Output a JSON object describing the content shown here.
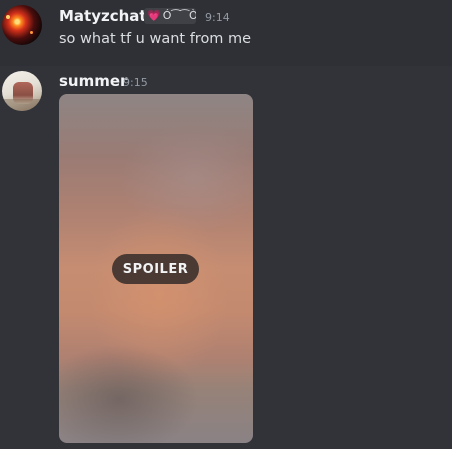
{
  "messages": [
    {
      "author": "Matyzchaty",
      "role_tag": {
        "icon": "heart-icon",
        "text": "Ó⁀⁀Ò"
      },
      "timestamp": "9:14",
      "content": "so what tf u want from me"
    },
    {
      "author": "summer",
      "timestamp": "9:15",
      "attachment": {
        "type": "image",
        "spoiler_label": "SPOILER"
      }
    }
  ],
  "colors": {
    "background": "#313338",
    "hovered_message": "#2e3035",
    "username": "#f2f3f5",
    "message_text": "#dbdee1",
    "timestamp": "#949ba4",
    "role_heart": "#ff7ac8"
  }
}
